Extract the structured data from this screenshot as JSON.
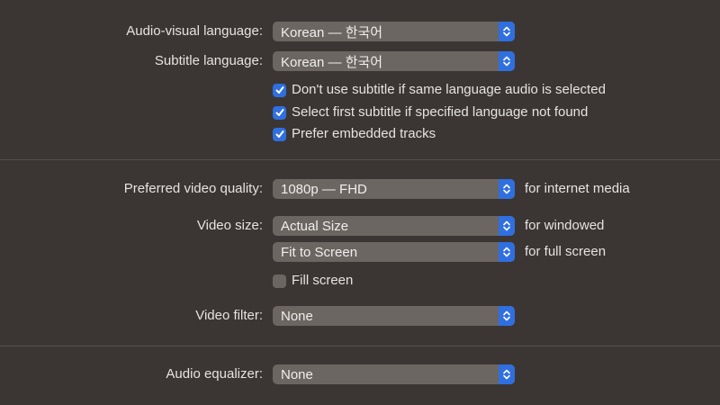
{
  "audio_visual_language": {
    "label": "Audio-visual language:",
    "value": "Korean — 한국어"
  },
  "subtitle_language": {
    "label": "Subtitle language:",
    "value": "Korean — 한국어"
  },
  "checkboxes": [
    {
      "label": "Don't use subtitle if same language audio is selected",
      "checked": true
    },
    {
      "label": "Select first subtitle if specified language not found",
      "checked": true
    },
    {
      "label": "Prefer embedded tracks",
      "checked": true
    }
  ],
  "video_quality": {
    "label": "Preferred video quality:",
    "value": "1080p — FHD",
    "suffix": "for internet media"
  },
  "video_size": {
    "label": "Video size:",
    "value": "Actual Size",
    "suffix": "for windowed"
  },
  "full_screen_size": {
    "value": "Fit to Screen",
    "suffix": "for full screen"
  },
  "fill_screen": {
    "label": "Fill screen",
    "checked": false
  },
  "video_filter": {
    "label": "Video filter:",
    "value": "None"
  },
  "audio_equalizer": {
    "label": "Audio equalizer:",
    "value": "None"
  }
}
